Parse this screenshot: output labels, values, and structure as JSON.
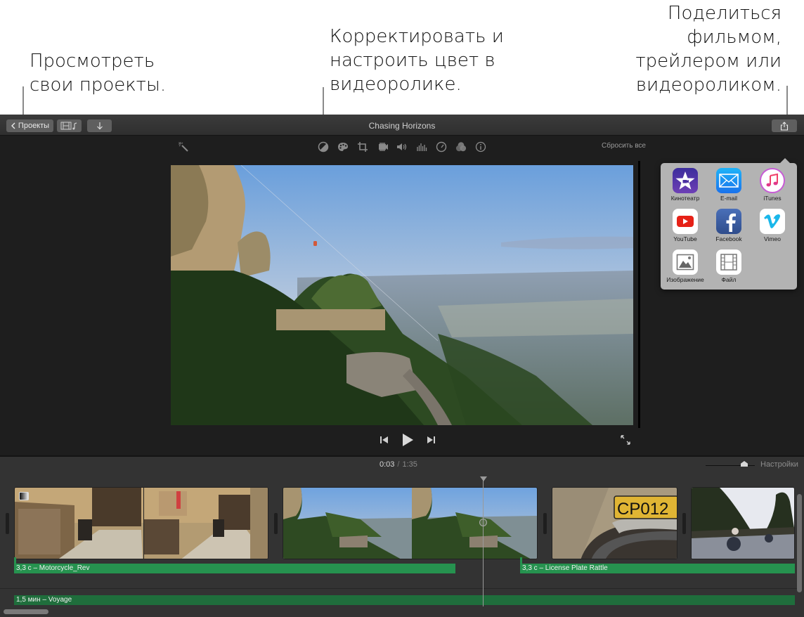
{
  "callouts": {
    "projects": [
      "Просмотреть",
      "свои проекты."
    ],
    "color": [
      "Корректировать и",
      "настроить цвет в",
      "видеоролике."
    ],
    "share": [
      "Поделиться",
      "фильмом,",
      "трейлером или",
      "видеороликом."
    ]
  },
  "toolbar": {
    "projects_button": "Проекты",
    "media_browser_icon": "film-music-icon",
    "import_icon": "download-arrow-icon",
    "title": "Chasing Horizons",
    "share_icon": "share-icon"
  },
  "adjustments": {
    "icons": [
      "magic-wand-icon",
      "color-balance-icon",
      "color-palette-icon",
      "crop-icon",
      "stabilization-camera-icon",
      "volume-icon",
      "equalizer-icon",
      "speed-gauge-icon",
      "filter-icon",
      "info-icon"
    ],
    "reset_all": "Сбросить все"
  },
  "viewer": {
    "controls": [
      "skip-back-icon",
      "play-icon",
      "skip-forward-icon"
    ],
    "fullscreen_icon": "fullscreen-icon"
  },
  "share_menu": {
    "items": [
      {
        "label": "Кинотеатр",
        "icon": "theater-icon",
        "color": "#4a2fa0"
      },
      {
        "label": "E-mail",
        "icon": "mail-icon",
        "color": "#1a8cf0"
      },
      {
        "label": "iTunes",
        "icon": "itunes-icon",
        "color": "#f0406a"
      },
      {
        "label": "YouTube",
        "icon": "youtube-icon",
        "color": "#e62117"
      },
      {
        "label": "Facebook",
        "icon": "facebook-icon",
        "color": "#3b5998"
      },
      {
        "label": "Vimeo",
        "icon": "vimeo-icon",
        "color": "#1ab7ea"
      },
      {
        "label": "Изображение",
        "icon": "image-icon",
        "color": "#666666"
      },
      {
        "label": "Файл",
        "icon": "file-film-icon",
        "color": "#666666"
      }
    ]
  },
  "timeline": {
    "current_time": "0:03",
    "separator": "/",
    "total_time": "1:35",
    "zoom_level": 0.78,
    "settings_label": "Настройки",
    "clips": [
      {
        "name": "village-motorcycle-clip"
      },
      {
        "name": "mountain-road-clip"
      },
      {
        "name": "license-plate-clip"
      },
      {
        "name": "riders-road-clip"
      }
    ],
    "audio_clips": [
      {
        "label": "3,3 с – Motorcycle_Rev"
      },
      {
        "label": "3,3 с – License Plate Rattle"
      }
    ],
    "music": {
      "label": "1,5 мин – Voyage"
    },
    "colors": {
      "audio": "#26924f",
      "music": "#1f6e3c"
    }
  }
}
